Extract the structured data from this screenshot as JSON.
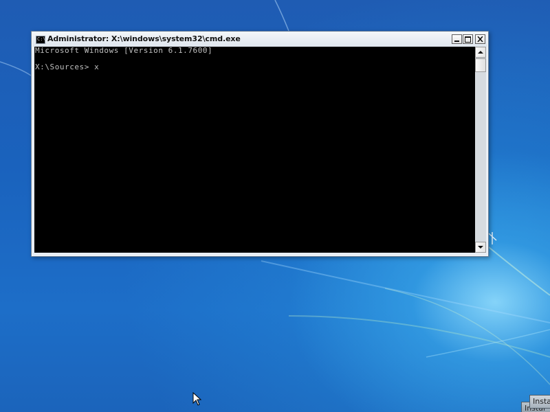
{
  "window": {
    "title": "Administrator: X:\\windows\\system32\\cmd.exe",
    "icon": "cmd-icon",
    "icon_glyph": "C:\\",
    "buttons": [
      "minimize",
      "maximize",
      "close"
    ]
  },
  "console": {
    "lines": [
      "Microsoft Windows [Version 6.1.7600]",
      "",
      "X:\\Sources> x"
    ],
    "text_color": "#c0c0c0",
    "background_color": "#000000"
  },
  "taskbar_buttons": {
    "install_front": "Insta",
    "install_back": "Instal"
  },
  "colors": {
    "desktop_blue": "#1f5cb3",
    "window_frame": "#e9eef4"
  }
}
